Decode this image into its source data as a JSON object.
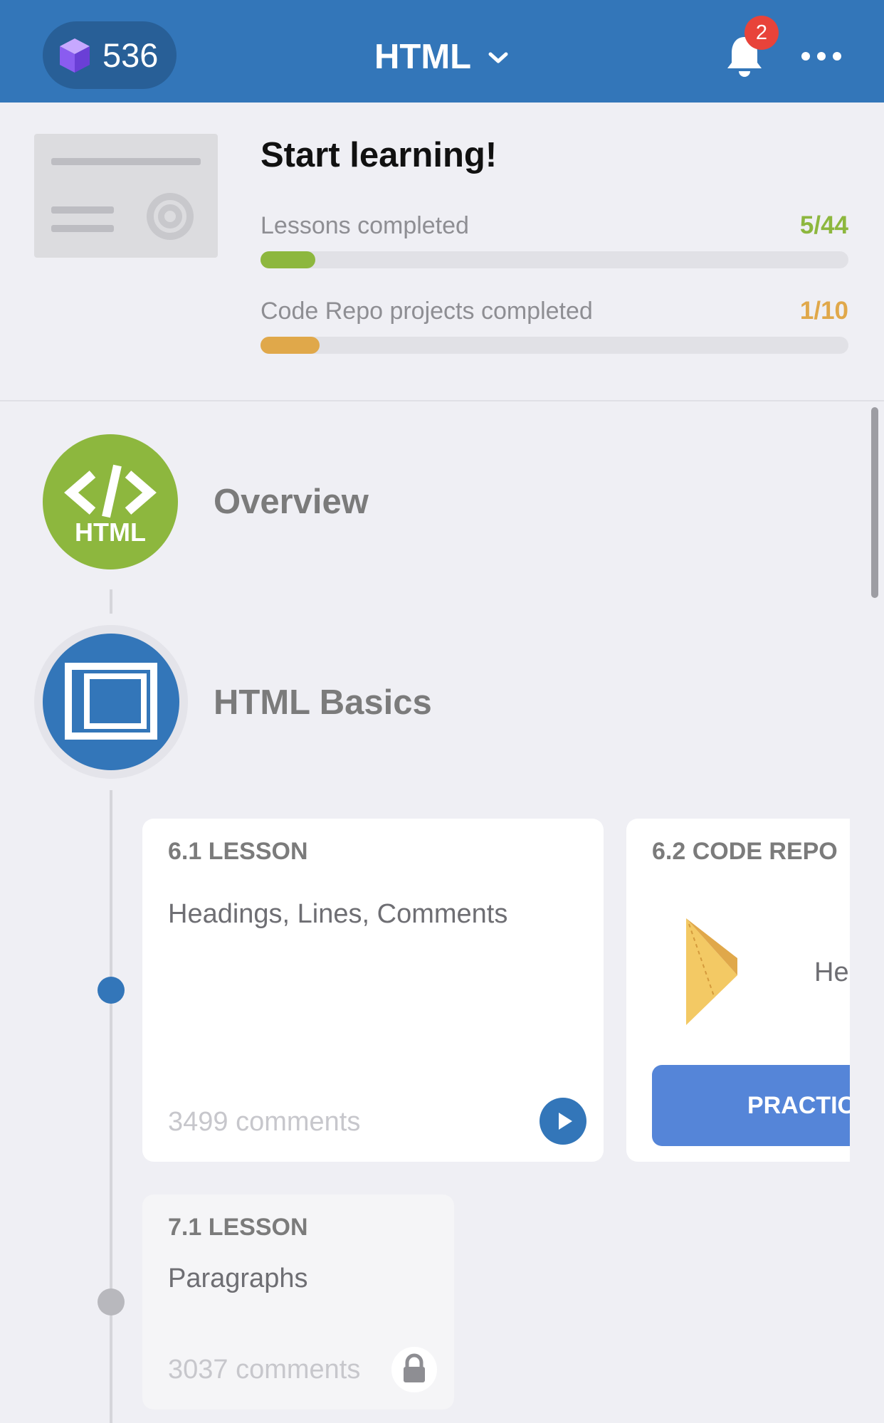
{
  "header": {
    "gems": "536",
    "title": "HTML",
    "notifications_count": "2",
    "icons": [
      "gem-icon",
      "chevron-down-icon",
      "bell-icon",
      "more-icon"
    ]
  },
  "progress": {
    "heading": "Start learning!",
    "lessons": {
      "label": "Lessons completed",
      "value": "5/44",
      "fraction": 0.1136,
      "color": "#8db73e"
    },
    "projects": {
      "label": "Code Repo projects completed",
      "value": "1/10",
      "fraction": 0.1,
      "color": "#e0a84a"
    }
  },
  "timeline": {
    "overview": {
      "label": "Overview",
      "icon_text": "HTML",
      "icon_color": "#8db73e"
    },
    "basics": {
      "label": "HTML Basics",
      "icon_color": "#3376b9"
    }
  },
  "cards": {
    "lesson_6_1": {
      "kicker": "6.1 LESSON",
      "title": "Headings, Lines, Comments",
      "comments": "3499 comments"
    },
    "repo_6_2": {
      "kicker": "6.2 CODE REPO",
      "title_partial": "He",
      "button": "PRACTICE"
    },
    "lesson_7_1": {
      "kicker": "7.1 LESSON",
      "title": "Paragraphs",
      "comments": "3037 comments"
    }
  },
  "colors": {
    "header_bg": "#3376b9",
    "accent_blue": "#3376b9",
    "lesson_green": "#8db73e",
    "repo_orange": "#e0a84a",
    "badge_red": "#e8433a",
    "practice_blue": "#5585d8"
  }
}
